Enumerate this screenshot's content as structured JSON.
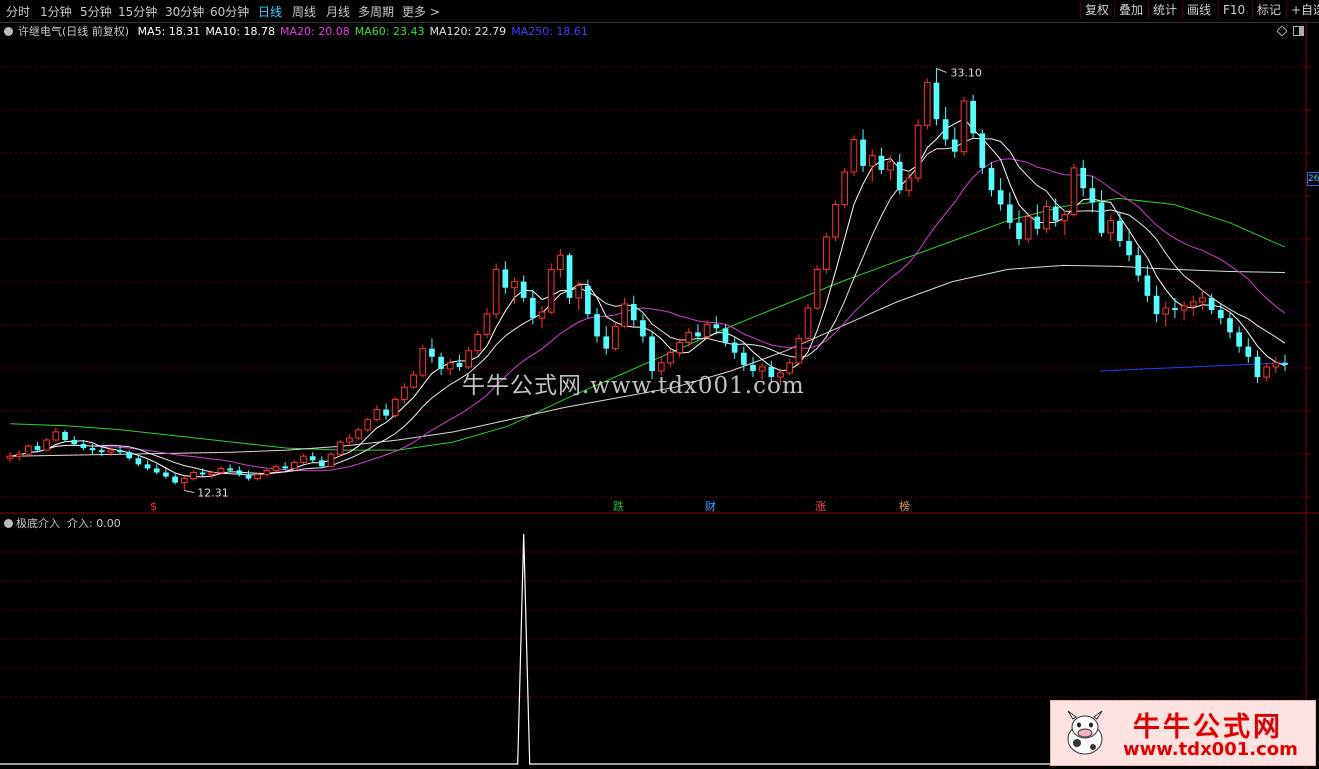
{
  "toolbar": {
    "periods": [
      "分时",
      "1分钟",
      "5分钟",
      "15分钟",
      "30分钟",
      "60分钟",
      "日线",
      "周线",
      "月线",
      "多周期",
      "更多 >"
    ],
    "active_period": "日线",
    "right_buttons": [
      "复权",
      "叠加",
      "统计",
      "画线",
      "F10",
      "标记",
      "+自选"
    ]
  },
  "stock": {
    "title": "许继电气(日线 前复权)",
    "ma": [
      {
        "label": "MA5: 18.31",
        "color": "#ffffff"
      },
      {
        "label": "MA10: 18.78",
        "color": "#ffffff"
      },
      {
        "label": "MA20: 20.08",
        "color": "#e040e0"
      },
      {
        "label": "MA60: 23.43",
        "color": "#40e040"
      },
      {
        "label": "MA120: 22.79",
        "color": "#e0e0e0"
      },
      {
        "label": "MA250: 18.61",
        "color": "#4040ff"
      }
    ]
  },
  "annotations": {
    "high": "33.10",
    "low": "12.31",
    "price_tag": "26"
  },
  "markers": [
    {
      "text": "$",
      "color": "#ff3030"
    },
    {
      "text": "跌",
      "color": "#20c020"
    },
    {
      "text": "财",
      "color": "#40a0ff"
    },
    {
      "text": "涨",
      "color": "#ff5050"
    },
    {
      "text": "榜",
      "color": "#e0a040"
    }
  ],
  "indicator": {
    "name": "极底介入",
    "value_label": "介入: 0.00"
  },
  "watermark": "牛牛公式网.www.tdx001.com",
  "logo": {
    "title": "牛牛公式网",
    "url": "www.tdx001.com"
  },
  "chart_data": {
    "type": "candlestick",
    "title": "许继电气(日线 前复权)",
    "price_range": [
      11.5,
      34.5
    ],
    "high": 33.1,
    "low": 12.31,
    "ohlc": [
      [
        13.9,
        14.2,
        13.7,
        14.0
      ],
      [
        14.0,
        14.3,
        13.8,
        14.1
      ],
      [
        14.1,
        14.6,
        14.0,
        14.5
      ],
      [
        14.5,
        14.7,
        14.2,
        14.3
      ],
      [
        14.3,
        14.9,
        14.3,
        14.8
      ],
      [
        14.8,
        15.4,
        14.7,
        15.2
      ],
      [
        15.2,
        15.3,
        14.7,
        14.8
      ],
      [
        14.8,
        15.0,
        14.5,
        14.6
      ],
      [
        14.6,
        14.8,
        14.3,
        14.4
      ],
      [
        14.4,
        14.6,
        14.1,
        14.3
      ],
      [
        14.3,
        14.5,
        14.0,
        14.2
      ],
      [
        14.2,
        14.4,
        14.0,
        14.3
      ],
      [
        14.3,
        14.5,
        14.1,
        14.2
      ],
      [
        14.2,
        14.3,
        13.8,
        13.9
      ],
      [
        13.9,
        14.0,
        13.5,
        13.6
      ],
      [
        13.6,
        13.8,
        13.3,
        13.4
      ],
      [
        13.4,
        13.6,
        13.1,
        13.2
      ],
      [
        13.2,
        13.4,
        12.9,
        13.0
      ],
      [
        13.0,
        13.2,
        12.6,
        12.7
      ],
      [
        12.7,
        13.0,
        12.31,
        12.9
      ],
      [
        12.9,
        13.3,
        12.8,
        13.2
      ],
      [
        13.2,
        13.4,
        13.0,
        13.1
      ],
      [
        13.1,
        13.3,
        12.9,
        13.2
      ],
      [
        13.2,
        13.5,
        13.1,
        13.4
      ],
      [
        13.4,
        13.6,
        13.2,
        13.3
      ],
      [
        13.3,
        13.5,
        13.0,
        13.1
      ],
      [
        13.1,
        13.3,
        12.8,
        12.9
      ],
      [
        12.9,
        13.2,
        12.8,
        13.1
      ],
      [
        13.1,
        13.4,
        13.0,
        13.3
      ],
      [
        13.3,
        13.6,
        13.2,
        13.5
      ],
      [
        13.5,
        13.7,
        13.3,
        13.4
      ],
      [
        13.4,
        13.8,
        13.4,
        13.7
      ],
      [
        13.7,
        14.1,
        13.6,
        14.0
      ],
      [
        14.0,
        14.2,
        13.7,
        13.8
      ],
      [
        13.8,
        14.0,
        13.4,
        13.5
      ],
      [
        13.5,
        14.2,
        13.5,
        14.1
      ],
      [
        14.1,
        14.8,
        14.0,
        14.7
      ],
      [
        14.7,
        15.1,
        14.5,
        14.9
      ],
      [
        14.9,
        15.4,
        14.8,
        15.3
      ],
      [
        15.3,
        15.9,
        15.2,
        15.8
      ],
      [
        15.8,
        16.5,
        15.7,
        16.3
      ],
      [
        16.3,
        16.6,
        15.8,
        16.0
      ],
      [
        16.0,
        16.9,
        15.9,
        16.8
      ],
      [
        16.8,
        17.6,
        16.6,
        17.4
      ],
      [
        17.4,
        18.2,
        17.3,
        18.0
      ],
      [
        18.0,
        19.5,
        17.9,
        19.3
      ],
      [
        19.3,
        19.8,
        18.6,
        18.9
      ],
      [
        18.9,
        19.1,
        18.0,
        18.3
      ],
      [
        18.3,
        18.8,
        18.0,
        18.6
      ],
      [
        18.6,
        19.0,
        18.2,
        18.4
      ],
      [
        18.4,
        19.4,
        18.3,
        19.2
      ],
      [
        19.2,
        20.2,
        19.0,
        20.0
      ],
      [
        20.0,
        21.3,
        19.8,
        21.0
      ],
      [
        21.0,
        23.5,
        20.8,
        23.2
      ],
      [
        23.2,
        23.6,
        22.0,
        22.3
      ],
      [
        22.3,
        22.8,
        21.5,
        22.6
      ],
      [
        22.6,
        22.9,
        21.6,
        21.8
      ],
      [
        21.8,
        22.2,
        20.5,
        20.8
      ],
      [
        20.8,
        21.4,
        20.3,
        21.1
      ],
      [
        21.1,
        23.5,
        21.0,
        23.2
      ],
      [
        23.2,
        24.2,
        22.8,
        23.9
      ],
      [
        23.9,
        24.0,
        21.5,
        21.8
      ],
      [
        21.8,
        22.6,
        21.2,
        22.4
      ],
      [
        22.4,
        22.7,
        20.8,
        21.0
      ],
      [
        21.0,
        21.3,
        19.6,
        19.9
      ],
      [
        19.9,
        20.4,
        19.0,
        19.3
      ],
      [
        19.3,
        20.6,
        19.2,
        20.4
      ],
      [
        20.4,
        21.8,
        20.3,
        21.5
      ],
      [
        21.5,
        21.9,
        20.4,
        20.7
      ],
      [
        20.7,
        21.0,
        19.6,
        19.9
      ],
      [
        19.9,
        20.1,
        17.8,
        18.2
      ],
      [
        18.2,
        18.9,
        18.0,
        18.6
      ],
      [
        18.6,
        19.3,
        18.4,
        19.1
      ],
      [
        19.1,
        19.8,
        18.9,
        19.6
      ],
      [
        19.6,
        20.3,
        19.4,
        20.1
      ],
      [
        20.1,
        20.5,
        19.7,
        19.9
      ],
      [
        19.9,
        20.7,
        19.8,
        20.5
      ],
      [
        20.5,
        20.9,
        20.0,
        20.3
      ],
      [
        20.3,
        20.5,
        19.4,
        19.6
      ],
      [
        19.6,
        19.9,
        18.8,
        19.1
      ],
      [
        19.1,
        19.4,
        18.2,
        18.5
      ],
      [
        18.5,
        18.9,
        17.9,
        18.2
      ],
      [
        18.2,
        18.6,
        17.8,
        18.4
      ],
      [
        18.4,
        18.7,
        17.6,
        17.9
      ],
      [
        17.9,
        18.3,
        17.5,
        18.1
      ],
      [
        18.1,
        18.8,
        18.0,
        18.6
      ],
      [
        18.6,
        20.0,
        18.5,
        19.8
      ],
      [
        19.8,
        21.5,
        19.6,
        21.3
      ],
      [
        21.3,
        23.4,
        21.2,
        23.2
      ],
      [
        23.2,
        25.0,
        23.0,
        24.8
      ],
      [
        24.8,
        26.6,
        24.6,
        26.4
      ],
      [
        26.4,
        28.2,
        26.2,
        28.0
      ],
      [
        28.0,
        29.8,
        27.8,
        29.6
      ],
      [
        29.6,
        30.1,
        28.0,
        28.3
      ],
      [
        28.3,
        29.1,
        27.5,
        28.8
      ],
      [
        28.8,
        29.2,
        27.9,
        28.1
      ],
      [
        28.1,
        28.8,
        27.6,
        28.5
      ],
      [
        28.5,
        28.9,
        26.9,
        27.1
      ],
      [
        27.1,
        28.0,
        26.8,
        27.7
      ],
      [
        27.7,
        30.6,
        27.5,
        30.3
      ],
      [
        30.3,
        32.6,
        30.1,
        32.4
      ],
      [
        32.4,
        33.1,
        30.3,
        30.6
      ],
      [
        30.6,
        31.2,
        29.3,
        29.6
      ],
      [
        29.6,
        30.2,
        28.7,
        29.0
      ],
      [
        29.0,
        31.7,
        28.8,
        31.5
      ],
      [
        31.5,
        31.8,
        29.7,
        29.9
      ],
      [
        29.9,
        30.1,
        27.9,
        28.2
      ],
      [
        28.2,
        28.5,
        26.8,
        27.1
      ],
      [
        27.1,
        27.7,
        26.1,
        26.4
      ],
      [
        26.4,
        27.0,
        25.2,
        25.5
      ],
      [
        25.5,
        26.1,
        24.4,
        24.7
      ],
      [
        24.7,
        26.0,
        24.5,
        25.8
      ],
      [
        25.8,
        26.4,
        24.9,
        25.2
      ],
      [
        25.2,
        26.6,
        25.0,
        26.3
      ],
      [
        26.3,
        26.7,
        25.3,
        25.6
      ],
      [
        25.6,
        26.1,
        24.9,
        25.9
      ],
      [
        25.9,
        28.4,
        25.8,
        28.2
      ],
      [
        28.2,
        28.6,
        26.8,
        27.2
      ],
      [
        27.2,
        27.8,
        26.0,
        26.5
      ],
      [
        26.5,
        27.1,
        24.8,
        25.0
      ],
      [
        25.0,
        25.9,
        24.6,
        25.6
      ],
      [
        25.6,
        26.0,
        24.3,
        24.6
      ],
      [
        24.6,
        25.2,
        23.6,
        23.9
      ],
      [
        23.9,
        24.3,
        22.6,
        22.9
      ],
      [
        22.9,
        23.4,
        21.6,
        21.9
      ],
      [
        21.9,
        22.4,
        20.6,
        21.0
      ],
      [
        21.0,
        21.6,
        20.4,
        21.3
      ],
      [
        21.3,
        21.8,
        20.8,
        21.2
      ],
      [
        21.2,
        21.6,
        20.7,
        21.4
      ],
      [
        21.4,
        21.9,
        20.9,
        21.6
      ],
      [
        21.6,
        22.2,
        21.2,
        21.8
      ],
      [
        21.8,
        22.0,
        21.0,
        21.2
      ],
      [
        21.2,
        21.5,
        20.5,
        20.8
      ],
      [
        20.8,
        21.1,
        19.8,
        20.1
      ],
      [
        20.1,
        20.4,
        19.1,
        19.4
      ],
      [
        19.4,
        19.8,
        18.6,
        18.9
      ],
      [
        18.9,
        19.2,
        17.6,
        17.9
      ],
      [
        17.9,
        18.6,
        17.7,
        18.4
      ],
      [
        18.4,
        18.9,
        18.1,
        18.6
      ],
      [
        18.6,
        19.0,
        18.2,
        18.5
      ]
    ],
    "ma_lines": [
      {
        "name": "MA60",
        "color": "#30d030",
        "values": [
          15.6,
          15.5,
          15.3,
          15.0,
          14.7,
          14.4,
          14.3,
          14.3,
          14.7,
          15.5,
          16.8,
          18.0,
          19.2,
          20.4,
          21.5,
          22.6,
          23.6,
          24.6,
          25.6,
          26.3,
          26.7,
          26.4,
          25.5,
          24.3
        ]
      },
      {
        "name": "MA120",
        "color": "#d8d8d8",
        "values": [
          14.0,
          14.05,
          14.1,
          14.15,
          14.2,
          14.3,
          14.5,
          14.8,
          15.2,
          15.8,
          16.4,
          16.9,
          17.4,
          18.2,
          19.2,
          20.4,
          21.6,
          22.6,
          23.2,
          23.4,
          23.35,
          23.2,
          23.1,
          23.05
        ]
      },
      {
        "name": "MA250",
        "color": "#2040ff",
        "values": [
          18.2,
          18.3,
          18.4,
          18.5,
          18.6
        ]
      }
    ],
    "indicator_values_spike_index": 56
  }
}
